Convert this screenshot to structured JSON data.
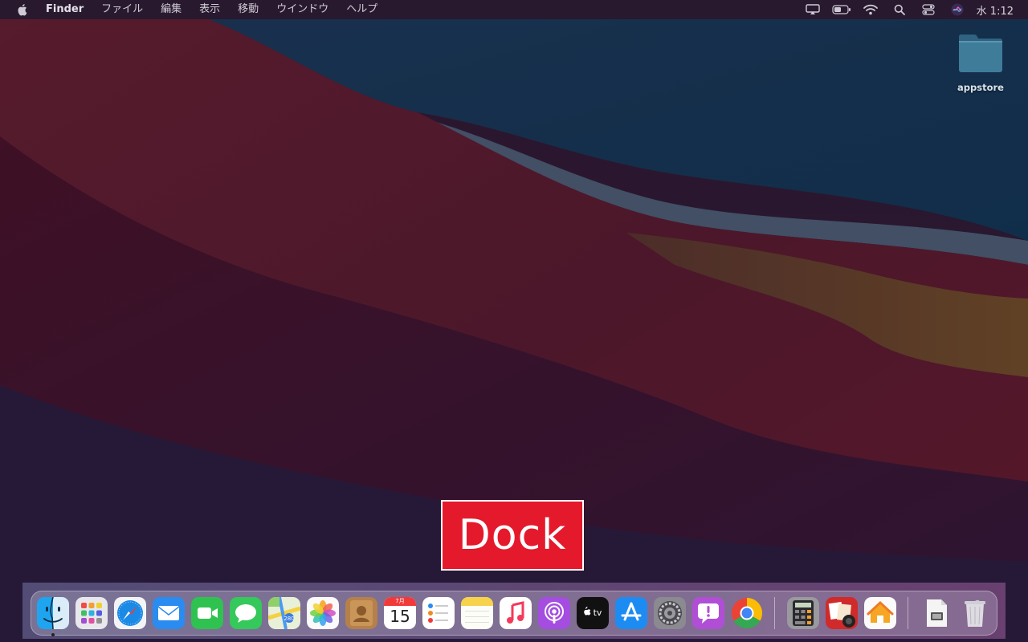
{
  "menubar": {
    "apple_icon": "apple-logo-icon",
    "app_name": "Finder",
    "menus": [
      "ファイル",
      "編集",
      "表示",
      "移動",
      "ウインドウ",
      "ヘルプ"
    ],
    "status_icons": [
      "airplay-icon",
      "battery-icon",
      "wifi-icon",
      "spotlight-search-icon",
      "control-center-icon",
      "siri-icon"
    ],
    "clock": "水 1:12"
  },
  "desktop": {
    "folder_label": "appstore"
  },
  "callout": {
    "text": "Dock",
    "color": "#e4192b"
  },
  "dock": {
    "apps": [
      "Finder",
      "Launchpad",
      "Safari",
      "Mail",
      "FaceTime",
      "Messages",
      "Maps",
      "Photos",
      "Contacts",
      "Calendar",
      "Reminders",
      "Notes",
      "Music",
      "Podcasts",
      "TV",
      "App Store",
      "System Preferences",
      "Feedback Assistant",
      "Google Chrome"
    ],
    "calendar_month": "7月",
    "calendar_day": "15",
    "tv_label": "tv",
    "extra_apps": [
      "Calculator",
      "Photo Booth",
      "Home"
    ],
    "right_items": [
      "Document",
      "Trash"
    ]
  }
}
